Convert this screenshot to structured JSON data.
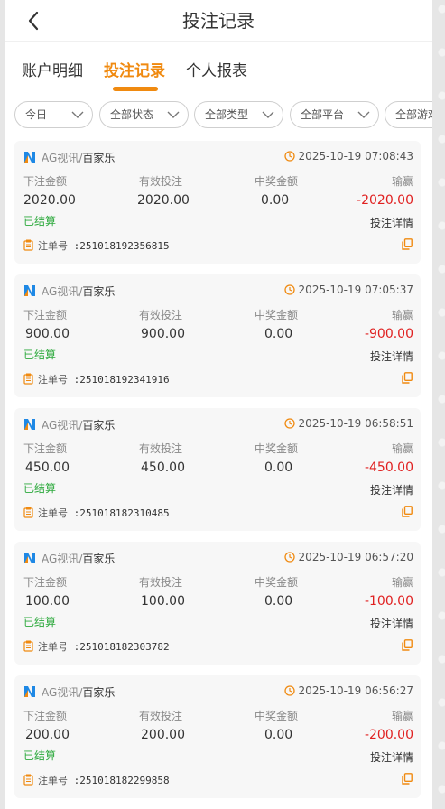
{
  "header": {
    "title": "投注记录",
    "back_icon": "chevron-left-icon"
  },
  "tabs": [
    {
      "label": "账户明细",
      "active": false
    },
    {
      "label": "投注记录",
      "active": true
    },
    {
      "label": "个人报表",
      "active": false
    }
  ],
  "filters": [
    "今日",
    "全部状态",
    "全部类型",
    "全部平台",
    "全部游戏"
  ],
  "labels": {
    "bet_amount": "下注金额",
    "valid_bet": "有效投注",
    "win_amount": "中奖金额",
    "profit": "输赢",
    "detail": "投注详情",
    "order_no": "注单号"
  },
  "colors": {
    "accent": "#f08a10",
    "settled": "#2eaa3e",
    "loss": "#e02020"
  },
  "records": [
    {
      "platform": "AG视讯",
      "game": "百家乐",
      "time": "2025-10-19 07:08:43",
      "bet": "2020.00",
      "valid": "2020.00",
      "win": "0.00",
      "profit": "-2020.00",
      "status": "已结算",
      "order": ":251018192356815"
    },
    {
      "platform": "AG视讯",
      "game": "百家乐",
      "time": "2025-10-19 07:05:37",
      "bet": "900.00",
      "valid": "900.00",
      "win": "0.00",
      "profit": "-900.00",
      "status": "已结算",
      "order": ":251018192341916"
    },
    {
      "platform": "AG视讯",
      "game": "百家乐",
      "time": "2025-10-19 06:58:51",
      "bet": "450.00",
      "valid": "450.00",
      "win": "0.00",
      "profit": "-450.00",
      "status": "已结算",
      "order": ":251018182310485"
    },
    {
      "platform": "AG视讯",
      "game": "百家乐",
      "time": "2025-10-19 06:57:20",
      "bet": "100.00",
      "valid": "100.00",
      "win": "0.00",
      "profit": "-100.00",
      "status": "已结算",
      "order": ":251018182303782"
    },
    {
      "platform": "AG视讯",
      "game": "百家乐",
      "time": "2025-10-19 06:56:27",
      "bet": "200.00",
      "valid": "200.00",
      "win": "0.00",
      "profit": "-200.00",
      "status": "已结算",
      "order": ":251018182299858"
    }
  ]
}
